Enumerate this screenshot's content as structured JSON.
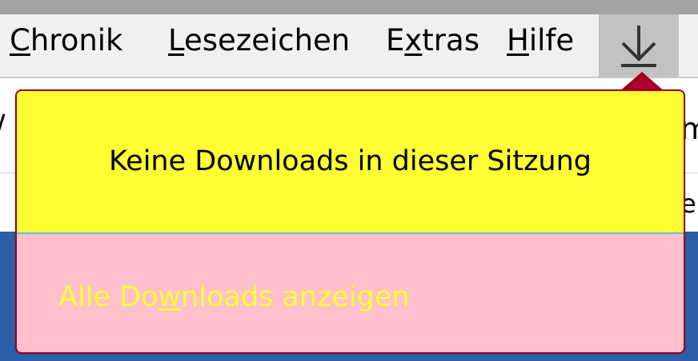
{
  "menubar": {
    "items": [
      {
        "label": "Chronik",
        "accel": "C"
      },
      {
        "label": "Lesezeichen",
        "accel": "L"
      },
      {
        "label": "Extras",
        "accel": "x"
      },
      {
        "label": "Hilfe",
        "accel": "H"
      }
    ],
    "download_button": {
      "icon": "download-arrow-icon"
    }
  },
  "downloads_panel": {
    "empty_message": "Keine Downloads in dieser Sitzung",
    "show_all_label": "Alle Downloads anzeigen",
    "show_all_accel": "w"
  },
  "colors": {
    "panel_top": "#ffff33",
    "panel_bottom": "#ffc0cb",
    "panel_border": "#9b0020",
    "show_all_text": "#ffff33",
    "page_blue": "#2b5fa6"
  }
}
